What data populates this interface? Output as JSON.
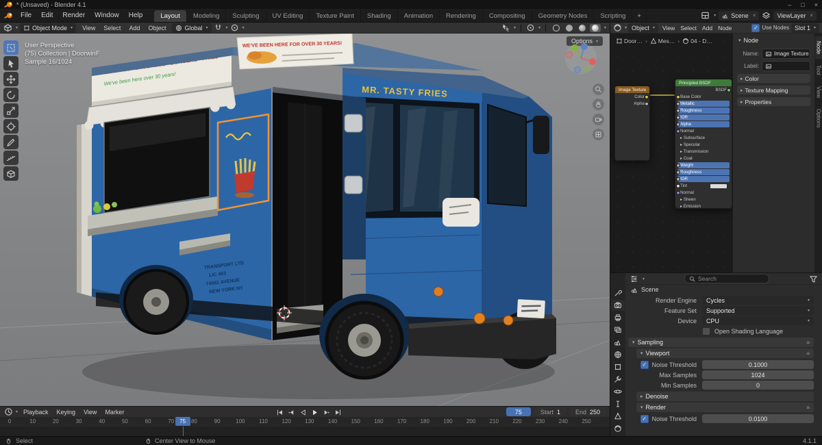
{
  "window": {
    "title": "* (Unsaved) - Blender 4.1"
  },
  "topbar": {
    "menus": [
      "File",
      "Edit",
      "Render",
      "Window",
      "Help"
    ],
    "workspaces": [
      "Layout",
      "Modeling",
      "Sculpting",
      "UV Editing",
      "Texture Paint",
      "Shading",
      "Animation",
      "Rendering",
      "Compositing",
      "Geometry Nodes",
      "Scripting"
    ],
    "active_workspace": "Layout",
    "add_workspace": "+",
    "scene": "Scene",
    "view_layer": "ViewLayer"
  },
  "viewport": {
    "header": {
      "mode": "Object Mode",
      "menus": [
        "View",
        "Select",
        "Add",
        "Object"
      ],
      "orientation": "Global",
      "options_label": "Options"
    },
    "tools": [
      "select-box",
      "cursor",
      "move",
      "rotate",
      "scale",
      "transform",
      "annotate",
      "measure",
      "add-cube"
    ],
    "active_tool_index": 0,
    "overlay": {
      "line1": "User Perspective",
      "line2": "(75) Collection | DoorwinF",
      "line3": "Sample 16/1024"
    }
  },
  "truck": {
    "roof_banner": "WE'VE BEEN HERE FOR OVER 30 YEARS!",
    "side_banner_line1": "HOT DOGS · SAUSAGES · BURGERS · FRIES",
    "side_banner_line2": "We've been here over 30 years!",
    "cab_text": "MR. TASTY FRIES",
    "door_lines": [
      "TRANSPORT LTD",
      "LIC 453",
      "74561 AVENUE",
      "NEW YORK NY"
    ]
  },
  "shader": {
    "header": {
      "shader_type": "Object",
      "menus": [
        "View",
        "Select",
        "Add",
        "Node"
      ],
      "use_nodes": "Use Nodes",
      "slot": "Slot 1"
    },
    "breadcrumb": [
      "Door…",
      "Mes…",
      "04 - D…"
    ],
    "nodes": {
      "image_texture": {
        "title": "Image Texture",
        "rows": [
          {
            "label": "Color",
            "kind": "output",
            "dot": "#d9c23f"
          },
          {
            "label": "Alpha",
            "kind": "output",
            "dot": "#b5b5b5"
          }
        ]
      },
      "principled": {
        "title": "Principled BSDF",
        "rows": [
          {
            "label": "BSDF",
            "kind": "output",
            "dot": "#6ecf6e"
          },
          {
            "label": "Base Color",
            "kind": "socket",
            "dot": "#d9c23f"
          },
          {
            "label": "Metallic",
            "kind": "slider",
            "dot": "#a8a8a8"
          },
          {
            "label": "Roughness",
            "kind": "slider",
            "dot": "#a8a8a8"
          },
          {
            "label": "IOR",
            "kind": "slider",
            "dot": "#a8a8a8"
          },
          {
            "label": "Alpha",
            "kind": "slider",
            "dot": "#a8a8a8"
          },
          {
            "label": "Normal",
            "kind": "socket",
            "dot": "#8a7fd6"
          },
          {
            "label": "Subsurface",
            "kind": "collapsed"
          },
          {
            "label": "Specular",
            "kind": "collapsed"
          },
          {
            "label": "Transmission",
            "kind": "collapsed"
          },
          {
            "label": "Coat",
            "kind": "collapsed"
          },
          {
            "label": "Weight",
            "kind": "slider",
            "dot": "#a8a8a8"
          },
          {
            "label": "Roughness",
            "kind": "slider",
            "dot": "#a8a8a8"
          },
          {
            "label": "IOR",
            "kind": "slider",
            "dot": "#a8a8a8"
          },
          {
            "label": "Tint",
            "kind": "color",
            "dot": "#e0e0e0"
          },
          {
            "label": "Normal",
            "kind": "socket",
            "dot": "#8a7fd6"
          },
          {
            "label": "Sheen",
            "kind": "collapsed"
          },
          {
            "label": "Emission",
            "kind": "collapsed"
          }
        ]
      }
    },
    "npanel": {
      "tab": "Node",
      "name_label": "Name:",
      "name_value": "Image Texture",
      "label_label": "Label:",
      "sections": [
        "Color",
        "Texture Mapping",
        "Properties"
      ],
      "side_tabs": [
        "Node",
        "Tool",
        "View",
        "Options"
      ],
      "active_side_tab": "Node"
    }
  },
  "properties": {
    "search_placeholder": "Search",
    "breadcrumb": "Scene",
    "tabs": [
      "tool",
      "render",
      "output",
      "view-layer",
      "scene",
      "world",
      "object",
      "modifiers",
      "physics",
      "constraints",
      "data",
      "material"
    ],
    "active_tab": "render",
    "rows": {
      "render_engine": {
        "label": "Render Engine",
        "value": "Cycles"
      },
      "feature_set": {
        "label": "Feature Set",
        "value": "Supported"
      },
      "device": {
        "label": "Device",
        "value": "CPU"
      },
      "osl": {
        "label": "Open Shading Language"
      },
      "sampling": "Sampling",
      "viewport": "Viewport",
      "noise_threshold": {
        "label": "Noise Threshold",
        "value": "0.1000"
      },
      "max_samples": {
        "label": "Max Samples",
        "value": "1024"
      },
      "min_samples": {
        "label": "Min Samples",
        "value": "0"
      },
      "denoise": "Denoise",
      "render": "Render",
      "render_noise_threshold": {
        "label": "Noise Threshold",
        "value": "0.0100"
      }
    }
  },
  "timeline": {
    "menus": [
      "Playback",
      "Keying",
      "View",
      "Marker"
    ],
    "current_frame": "75",
    "start_label": "Start",
    "start_value": "1",
    "end_label": "End",
    "end_value": "250",
    "tick_start": 0,
    "tick_end": 250,
    "tick_step": 10
  },
  "statusbar": {
    "left": "Select",
    "middle": "Center View to Mouse",
    "right": "4.1.1"
  }
}
